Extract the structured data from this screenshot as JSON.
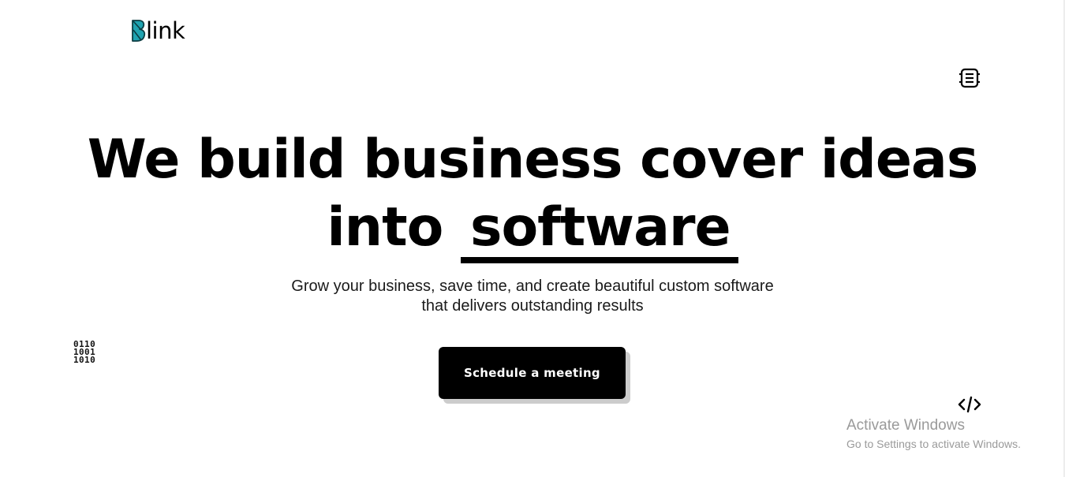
{
  "header": {
    "logo_text": "link",
    "logo_mark_letter": "B",
    "brand_color": "#1fa3b0",
    "menu_icon": "menu-icon"
  },
  "hero": {
    "title_line1": "We build business cover ideas",
    "title_line2_prefix": "into",
    "title_line2_highlight": "software",
    "subtitle_line1": "Grow your business, save time, and create beautiful custom software",
    "subtitle_line2": "that delivers outstanding results",
    "cta_label": "Schedule a meeting"
  },
  "decorations": {
    "binary_rows": [
      "0110",
      "1001",
      "1010"
    ],
    "binary_icon": "binary-icon",
    "code_icon": "code-icon"
  },
  "watermark": {
    "title": "Activate Windows",
    "subtitle": "Go to Settings to activate Windows."
  },
  "colors": {
    "background": "#ffffff",
    "text": "#000000",
    "button_bg": "#000000",
    "button_text": "#ffffff",
    "button_shadow": "#cccccc",
    "watermark": "#9a9a9a"
  }
}
